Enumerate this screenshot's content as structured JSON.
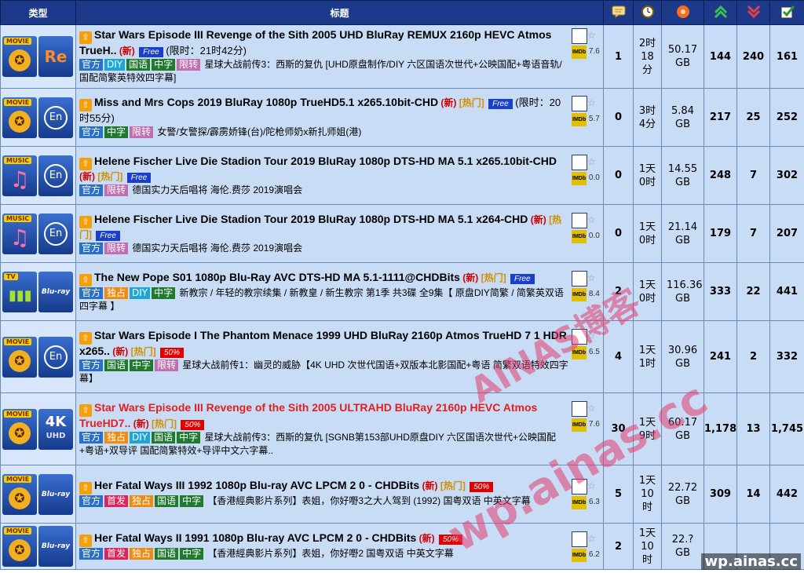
{
  "header": {
    "type_label": "类型",
    "title_label": "标题",
    "icons": [
      "comments-icon",
      "time-icon",
      "size-icon",
      "seeders-icon",
      "leechers-icon",
      "completed-icon"
    ]
  },
  "rows": [
    {
      "cat_label": "MOVIE",
      "codec": "Re",
      "title": "Star Wars Episode III Revenge of the Sith 2005 UHD BluRay REMUX 2160p HEVC Atmos TrueH..",
      "red": false,
      "new": "(新)",
      "hot": "",
      "badge": "Free",
      "badge_type": "free",
      "extra": "(限时：21时42分)",
      "tags": [
        [
          "官方",
          "t-blue"
        ],
        [
          "DIY",
          "t-cyan"
        ],
        [
          "国语",
          "t-green"
        ],
        [
          "中字",
          "t-green"
        ],
        [
          "限转",
          "t-pink"
        ]
      ],
      "desc": "星球大战前传3：西斯的复仇 [UHD原盘制作/DIY 六区国语次世代+公映国配+粤语音轨/国配简繁英特效四字幕]",
      "imdb": "7.6",
      "comments": "1",
      "time": "2时18分",
      "size": "50.17 GB",
      "seeders": "144",
      "leechers": "240",
      "completed": "161"
    },
    {
      "cat_label": "MOVIE",
      "codec": "En",
      "title": "Miss and Mrs Cops 2019 BluRay 1080p TrueHD5.1 x265.10bit-CHD",
      "red": false,
      "new": "(新)",
      "hot": "[热门]",
      "badge": "Free",
      "badge_type": "free",
      "extra": "(限时：20时55分)",
      "tags": [
        [
          "官方",
          "t-blue"
        ],
        [
          "中字",
          "t-green"
        ],
        [
          "限转",
          "t-pink"
        ]
      ],
      "desc": "女警/女警探/霹雳娇锋(台)/陀枪师奶x新扎师姐(港)",
      "imdb": "5.7",
      "comments": "0",
      "time": "3时4分",
      "size": "5.84 GB",
      "seeders": "217",
      "leechers": "25",
      "completed": "252"
    },
    {
      "cat_label": "MUSIC",
      "codec": "En",
      "title": "Helene Fischer Live Die Stadion Tour 2019 BluRay 1080p DTS-HD MA 5.1 x265.10bit-CHD",
      "red": false,
      "new": "(新)",
      "hot": "[热门]",
      "badge": "Free",
      "badge_type": "free",
      "extra": "",
      "tags": [
        [
          "官方",
          "t-blue"
        ],
        [
          "限转",
          "t-pink"
        ]
      ],
      "desc": "德国实力天后唱将 海伦.费莎 2019演唱会",
      "imdb": "0.0",
      "comments": "0",
      "time": "1天0时",
      "size": "14.55 GB",
      "seeders": "248",
      "leechers": "7",
      "completed": "302"
    },
    {
      "cat_label": "MUSIC",
      "codec": "En",
      "title": "Helene Fischer Live Die Stadion Tour 2019 BluRay 1080p DTS-HD MA 5.1 x264-CHD",
      "red": false,
      "new": "(新)",
      "hot": "[热门]",
      "badge": "Free",
      "badge_type": "free",
      "extra": "",
      "tags": [
        [
          "官方",
          "t-blue"
        ],
        [
          "限转",
          "t-pink"
        ]
      ],
      "desc": "德国实力天后唱将 海伦.费莎 2019演唱会",
      "imdb": "0.0",
      "comments": "0",
      "time": "1天0时",
      "size": "21.14 GB",
      "seeders": "179",
      "leechers": "7",
      "completed": "207"
    },
    {
      "cat_label": "TV",
      "codec": "Blu-ray",
      "title": "The New Pope S01 1080p Blu-Ray AVC DTS-HD MA 5.1-1111@CHDBits",
      "red": false,
      "new": "(新)",
      "hot": "[热门]",
      "badge": "Free",
      "badge_type": "free",
      "extra": "",
      "tags": [
        [
          "官方",
          "t-blue"
        ],
        [
          "独占",
          "t-orange"
        ],
        [
          "DIY",
          "t-cyan"
        ],
        [
          "中字",
          "t-green"
        ]
      ],
      "desc": "新教宗 / 年轻的教宗续集 / 新教皇 / 新生教宗 第1季 共3碟 全9集【 原盘DIY简繁 / 简繁英双语 四字幕 】",
      "imdb": "8.4",
      "comments": "2",
      "time": "1天0时",
      "size": "116.36 GB",
      "seeders": "333",
      "leechers": "22",
      "completed": "441"
    },
    {
      "cat_label": "MOVIE",
      "codec": "En",
      "title": "Star Wars Episode I The Phantom Menace 1999 UHD BluRay 2160p Atmos TrueHD 7 1 HDR x265..",
      "red": false,
      "new": "(新)",
      "hot": "[热门]",
      "badge": "50%",
      "badge_type": "pct",
      "extra": "",
      "tags": [
        [
          "官方",
          "t-blue"
        ],
        [
          "国语",
          "t-green"
        ],
        [
          "中字",
          "t-green"
        ],
        [
          "限转",
          "t-pink"
        ]
      ],
      "desc": "星球大战前传1：幽灵的威胁【4K UHD 次世代国语+双版本北影国配+粤语 简繁双语特效四字幕】",
      "imdb": "6.5",
      "comments": "4",
      "time": "1天1时",
      "size": "30.96 GB",
      "seeders": "241",
      "leechers": "2",
      "completed": "332"
    },
    {
      "cat_label": "MOVIE",
      "codec": "4K UHD",
      "title": "Star Wars Episode III Revenge of the Sith 2005 ULTRAHD BluRay 2160p HEVC Atmos TrueHD7..",
      "red": true,
      "new": "(新)",
      "hot": "[热门]",
      "badge": "50%",
      "badge_type": "pct",
      "extra": "",
      "tags": [
        [
          "官方",
          "t-blue"
        ],
        [
          "独占",
          "t-orange"
        ],
        [
          "DIY",
          "t-cyan"
        ],
        [
          "国语",
          "t-green"
        ],
        [
          "中字",
          "t-green"
        ]
      ],
      "desc": "星球大战前传3：西斯的复仇 [SGNB第153部UHD原盘DIY 六区国语次世代+公映国配+粤语+双导评 国配简繁特效+导评中文六字幕..",
      "imdb": "7.6",
      "comments": "30",
      "time": "1天9时",
      "size": "60.17 GB",
      "seeders": "1,178",
      "leechers": "13",
      "completed": "1,745"
    },
    {
      "cat_label": "MOVIE",
      "codec": "Blu-ray",
      "title": "Her Fatal Ways III 1992 1080p Blu-ray AVC LPCM 2 0 - CHDBits",
      "red": false,
      "new": "(新)",
      "hot": "[热门]",
      "badge": "50%",
      "badge_type": "pct",
      "extra": "",
      "tags": [
        [
          "官方",
          "t-blue"
        ],
        [
          "首发",
          "t-red"
        ],
        [
          "独占",
          "t-orange"
        ],
        [
          "国语",
          "t-green"
        ],
        [
          "中字",
          "t-green"
        ]
      ],
      "desc": "【香港經典影片系列】表姐，你好嘢3之大人驾到 (1992) 国粤双语 中英文字幕",
      "imdb": "6.3",
      "comments": "5",
      "time": "1天10时",
      "size": "22.72 GB",
      "seeders": "309",
      "leechers": "14",
      "completed": "442"
    },
    {
      "cat_label": "MOVIE",
      "codec": "Blu-ray",
      "title": "Her Fatal Ways II 1991 1080p Blu-ray AVC LPCM 2 0 - CHDBits",
      "red": false,
      "new": "(新)",
      "hot": "",
      "badge": "50%",
      "badge_type": "pct",
      "extra": "",
      "tags": [
        [
          "官方",
          "t-blue"
        ],
        [
          "首发",
          "t-red"
        ],
        [
          "独占",
          "t-orange"
        ],
        [
          "国语",
          "t-green"
        ],
        [
          "中字",
          "t-green"
        ]
      ],
      "desc": "【香港經典影片系列】表姐，你好嘢2 国粤双语 中英文字幕",
      "imdb": "6.2",
      "comments": "2",
      "time": "1天10时",
      "size": "22.? GB",
      "seeders": "",
      "leechers": "",
      "completed": ""
    }
  ],
  "watermarks": {
    "line1": "AINAS博客",
    "line2": "wp.ainas.cc",
    "corner": "wp.ainas.cc"
  }
}
